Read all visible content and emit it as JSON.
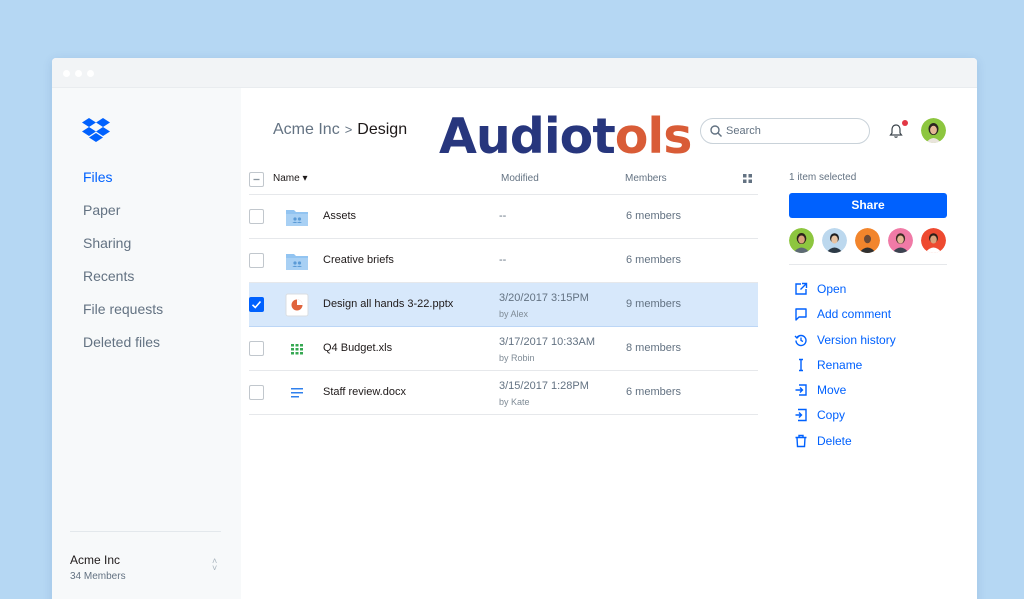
{
  "sidebar": {
    "nav": [
      "Files",
      "Paper",
      "Sharing",
      "Recents",
      "File requests",
      "Deleted files"
    ],
    "team": {
      "name": "Acme Inc",
      "members": "34 Members"
    }
  },
  "header": {
    "breadcrumb": {
      "parent": "Acme Inc",
      "separator": ">",
      "current": "Design"
    },
    "watermark": {
      "part1": "Audiot",
      "part2": "ols"
    },
    "search": {
      "placeholder": "Search"
    }
  },
  "table": {
    "columns": {
      "name": "Name ▾",
      "modified": "Modified",
      "members": "Members"
    },
    "rows": [
      {
        "name": "Assets",
        "modified": "--",
        "by": "",
        "members": "6 members",
        "type": "folder",
        "selected": false
      },
      {
        "name": "Creative briefs",
        "modified": "--",
        "by": "",
        "members": "6 members",
        "type": "folder",
        "selected": false
      },
      {
        "name": "Design all hands 3-22.pptx",
        "modified": "3/20/2017 3:15PM",
        "by": "by Alex",
        "members": "9 members",
        "type": "pptx",
        "selected": true
      },
      {
        "name": "Q4 Budget.xls",
        "modified": "3/17/2017 10:33AM",
        "by": "by Robin",
        "members": "8 members",
        "type": "xls",
        "selected": false
      },
      {
        "name": "Staff review.docx",
        "modified": "3/15/2017 1:28PM",
        "by": "by Kate",
        "members": "6 members",
        "type": "docx",
        "selected": false
      }
    ]
  },
  "panel": {
    "selection_text": "1 item selected",
    "share_label": "Share",
    "actions": [
      {
        "label": "Open",
        "icon": "open-external-icon"
      },
      {
        "label": "Add comment",
        "icon": "comment-icon"
      },
      {
        "label": "Version history",
        "icon": "history-icon"
      },
      {
        "label": "Rename",
        "icon": "rename-cursor-icon"
      },
      {
        "label": "Move",
        "icon": "move-icon"
      },
      {
        "label": "Copy",
        "icon": "copy-icon"
      },
      {
        "label": "Delete",
        "icon": "trash-icon"
      }
    ]
  },
  "colors": {
    "background": "#b5d7f3",
    "accent": "#0061fe",
    "selected_row": "#d7e8fb",
    "notification": "#e23744"
  }
}
